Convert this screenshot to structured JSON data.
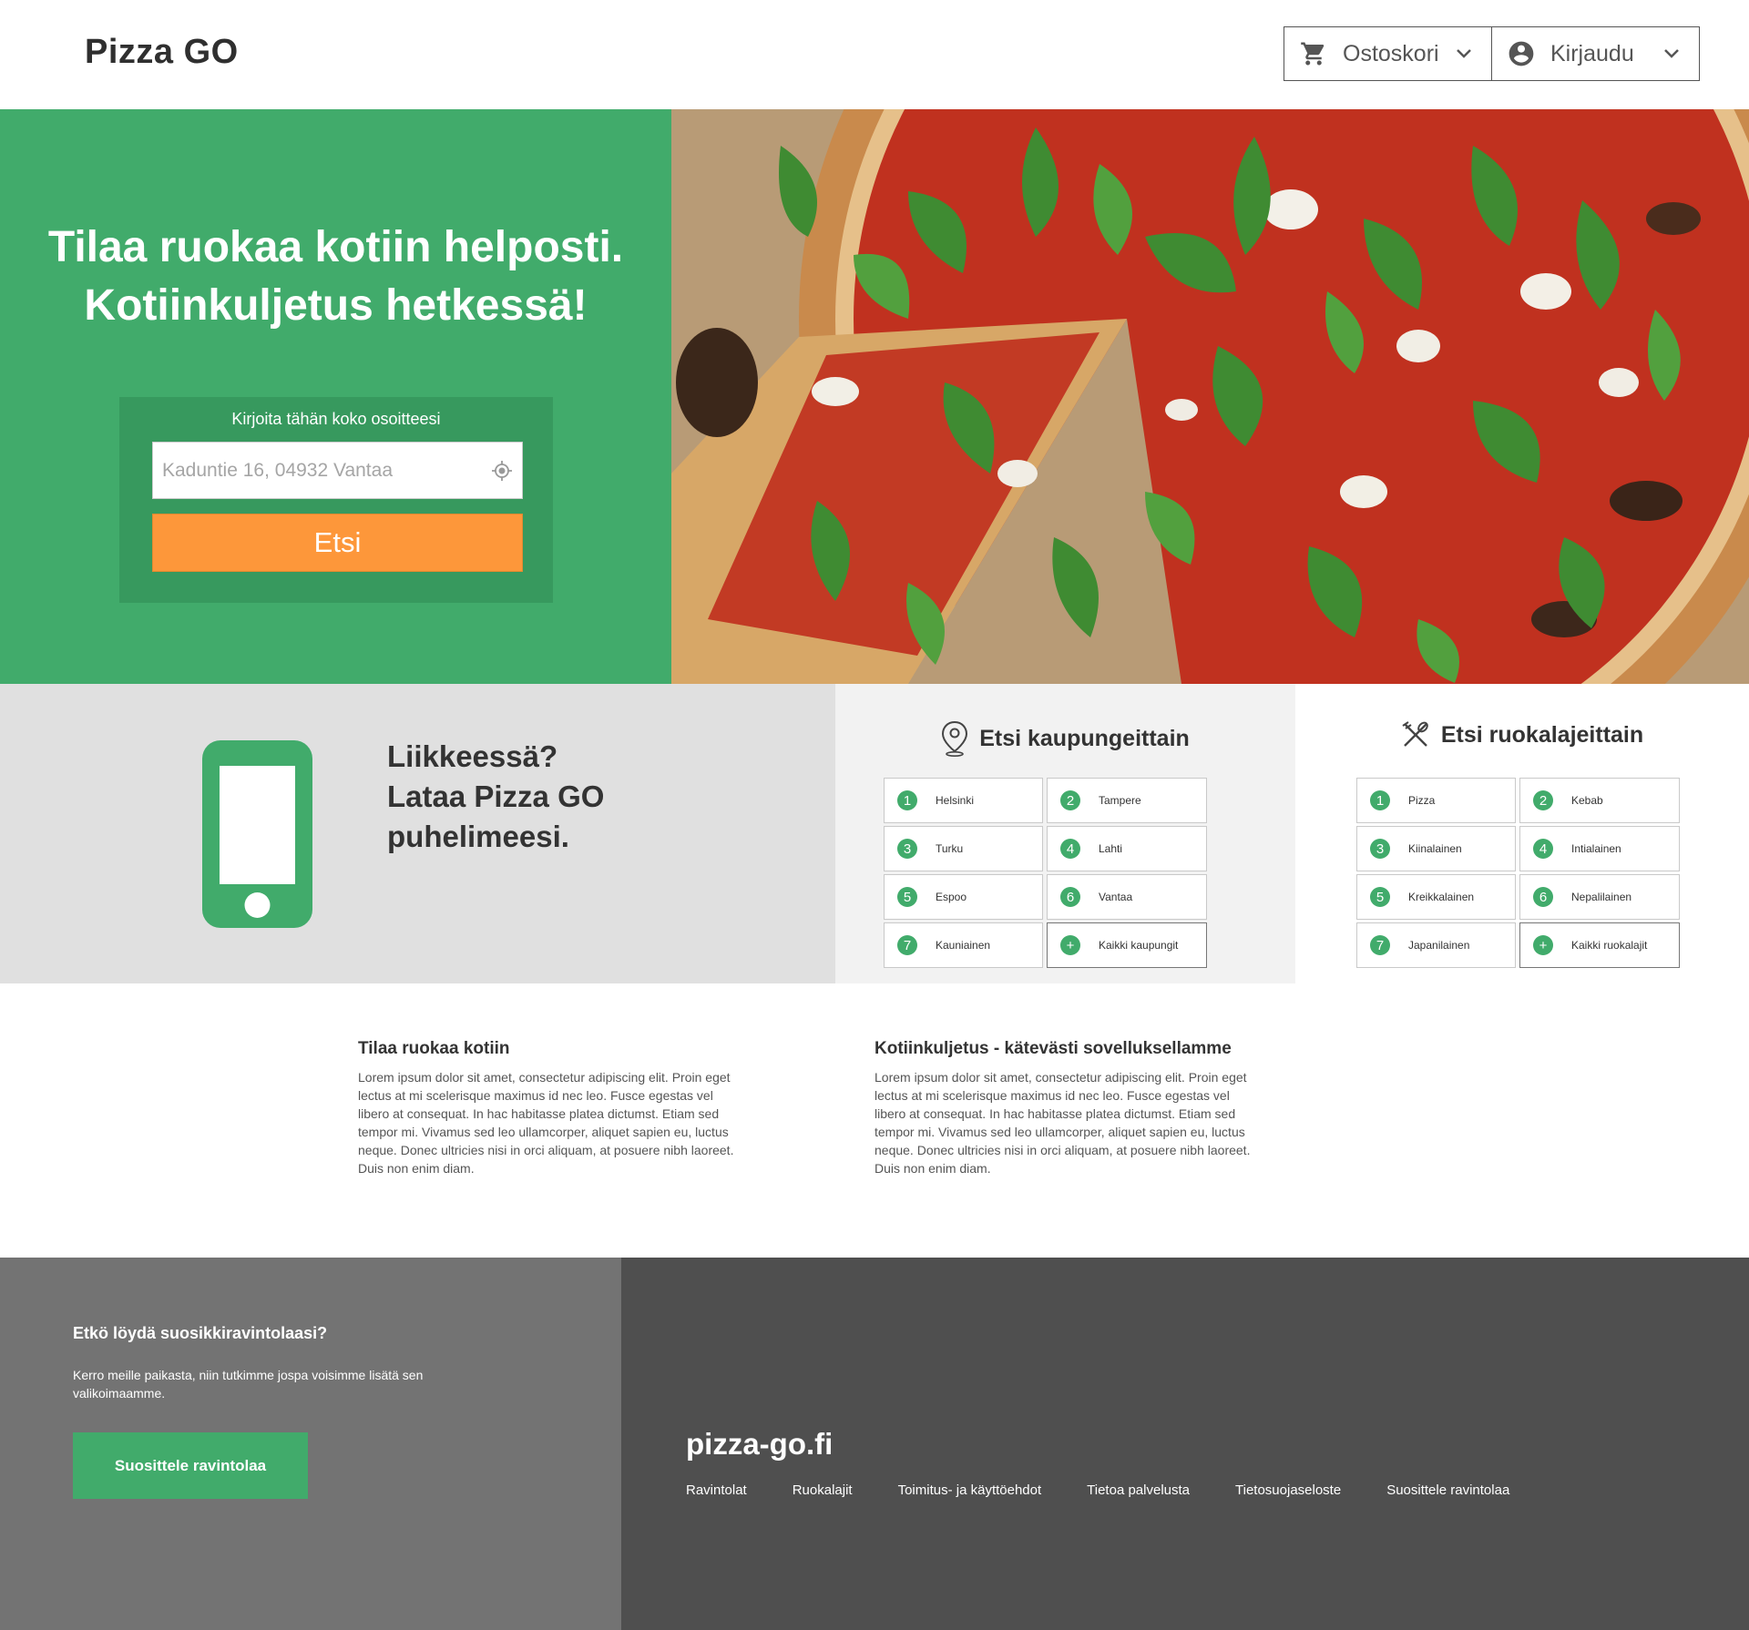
{
  "header": {
    "logo": "Pizza GO",
    "cart_label": "Ostoskori",
    "login_label": "Kirjaudu"
  },
  "hero": {
    "title_line1": "Tilaa ruokaa kotiin helposti.",
    "title_line2": "Kotiinkuljetus hetkessä!",
    "search_label": "Kirjoita tähän koko osoitteesi",
    "search_placeholder": "Kaduntie 16, 04932 Vantaa",
    "search_button": "Etsi"
  },
  "app": {
    "line1": "Liikkeessä?",
    "line2": "Lataa Pizza GO",
    "line3": "puhelimeesi."
  },
  "cities": {
    "title": "Etsi kaupungeittain",
    "items": [
      {
        "badge": "1",
        "label": "Helsinki"
      },
      {
        "badge": "2",
        "label": "Tampere"
      },
      {
        "badge": "3",
        "label": "Turku"
      },
      {
        "badge": "4",
        "label": "Lahti"
      },
      {
        "badge": "5",
        "label": "Espoo"
      },
      {
        "badge": "6",
        "label": "Vantaa"
      },
      {
        "badge": "7",
        "label": "Kauniainen"
      },
      {
        "badge": "+",
        "label": "Kaikki kaupungit"
      }
    ]
  },
  "categories": {
    "title": "Etsi ruokalajeittain",
    "items": [
      {
        "badge": "1",
        "label": "Pizza"
      },
      {
        "badge": "2",
        "label": "Kebab"
      },
      {
        "badge": "3",
        "label": "Kiinalainen"
      },
      {
        "badge": "4",
        "label": "Intialainen"
      },
      {
        "badge": "5",
        "label": "Kreikkalainen"
      },
      {
        "badge": "6",
        "label": "Nepalilainen"
      },
      {
        "badge": "7",
        "label": "Japanilainen"
      },
      {
        "badge": "+",
        "label": "Kaikki ruokalajit"
      }
    ]
  },
  "info": {
    "col1_title": "Tilaa ruokaa kotiin",
    "col1_text": "Lorem ipsum dolor sit amet, consectetur adipiscing elit. Proin eget lectus at mi scelerisque maximus id nec leo. Fusce egestas vel libero at consequat. In hac habitasse platea dictumst. Etiam sed tempor mi. Vivamus sed leo ullamcorper, aliquet sapien eu, luctus neque. Donec ultricies nisi in orci aliquam, at posuere nibh laoreet. Duis non enim diam.",
    "col2_title": "Kotiinkuljetus - kätevästi sovelluksellamme",
    "col2_text": "Lorem ipsum dolor sit amet, consectetur adipiscing elit. Proin eget lectus at mi scelerisque maximus id nec leo. Fusce egestas vel libero at consequat. In hac habitasse platea dictumst. Etiam sed tempor mi. Vivamus sed leo ullamcorper, aliquet sapien eu, luctus neque. Donec ultricies nisi in orci aliquam, at posuere nibh laoreet. Duis non enim diam."
  },
  "footer": {
    "suggest_title": "Etkö löydä suosikkiravintolaasi?",
    "suggest_text": "Kerro meille paikasta, niin tutkimme jospa voisimme lisätä sen valikoimaamme.",
    "suggest_button": "Suosittele ravintolaa",
    "brand": "pizza-go.fi",
    "links": [
      "Ravintolat",
      "Ruokalajit",
      "Toimitus- ja käyttöehdot",
      "Tietoa palvelusta",
      "Tietosuojaseloste",
      "Suosittele ravintolaa"
    ]
  },
  "colors": {
    "brand_green": "#41ab6b",
    "search_orange": "#fd973a",
    "footer_dark": "#4f4f4f",
    "footer_mid": "#737373"
  },
  "icons": [
    "cart-icon",
    "account-icon",
    "chevron-down-icon",
    "location-target-icon",
    "phone-icon",
    "map-pin-icon",
    "cutlery-icon"
  ]
}
